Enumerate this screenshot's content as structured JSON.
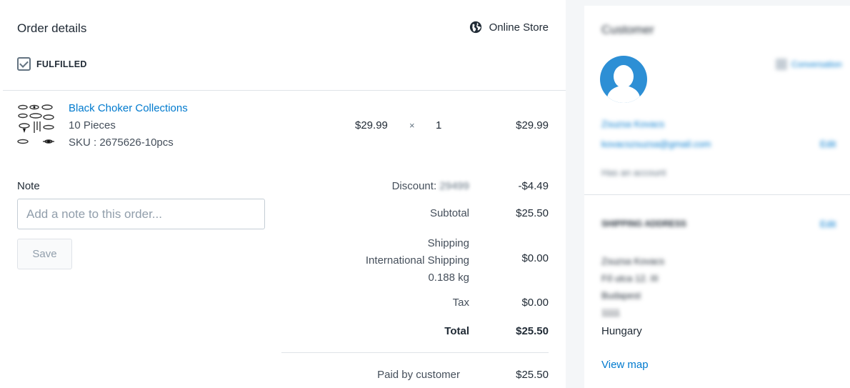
{
  "order": {
    "title": "Order details",
    "channel": "Online Store",
    "status": "FULFILLED"
  },
  "line_item": {
    "name": "Black Choker Collections",
    "variant": "10 Pieces",
    "sku": "SKU : 2675626-10pcs",
    "unit_price": "$29.99",
    "times": "×",
    "quantity": "1",
    "total": "$29.99"
  },
  "note": {
    "label": "Note",
    "placeholder": "Add a note to this order...",
    "save_label": "Save"
  },
  "summary": {
    "discount_label": "Discount:",
    "discount_code": "29499",
    "discount_value": "-$4.49",
    "subtotal_label": "Subtotal",
    "subtotal_value": "$25.50",
    "shipping_label": "Shipping",
    "shipping_method": "International Shipping",
    "shipping_weight": "0.188 kg",
    "shipping_value": "$0.00",
    "tax_label": "Tax",
    "tax_value": "$0.00",
    "total_label": "Total",
    "total_value": "$25.50",
    "paid_label": "Paid by customer",
    "paid_value": "$25.50"
  },
  "customer": {
    "title": "Customer",
    "conversation_link": "Conversation",
    "name": "Zsuzsa Kovacs",
    "email": "kovacszsuzsa@gmail.com",
    "edit": "Edit",
    "account_status": "Has an account",
    "shipping_title": "SHIPPING ADDRESS",
    "shipping_edit": "Edit",
    "address_name": "Zsuzsa Kovacs",
    "address_line1": "Fő utca 12. III",
    "address_city": "Budapest",
    "address_zip": "1111",
    "address_country": "Hungary",
    "view_map": "View map"
  },
  "colors": {
    "link": "#007ace",
    "background": "#f4f6f8",
    "text": "#212b36"
  }
}
